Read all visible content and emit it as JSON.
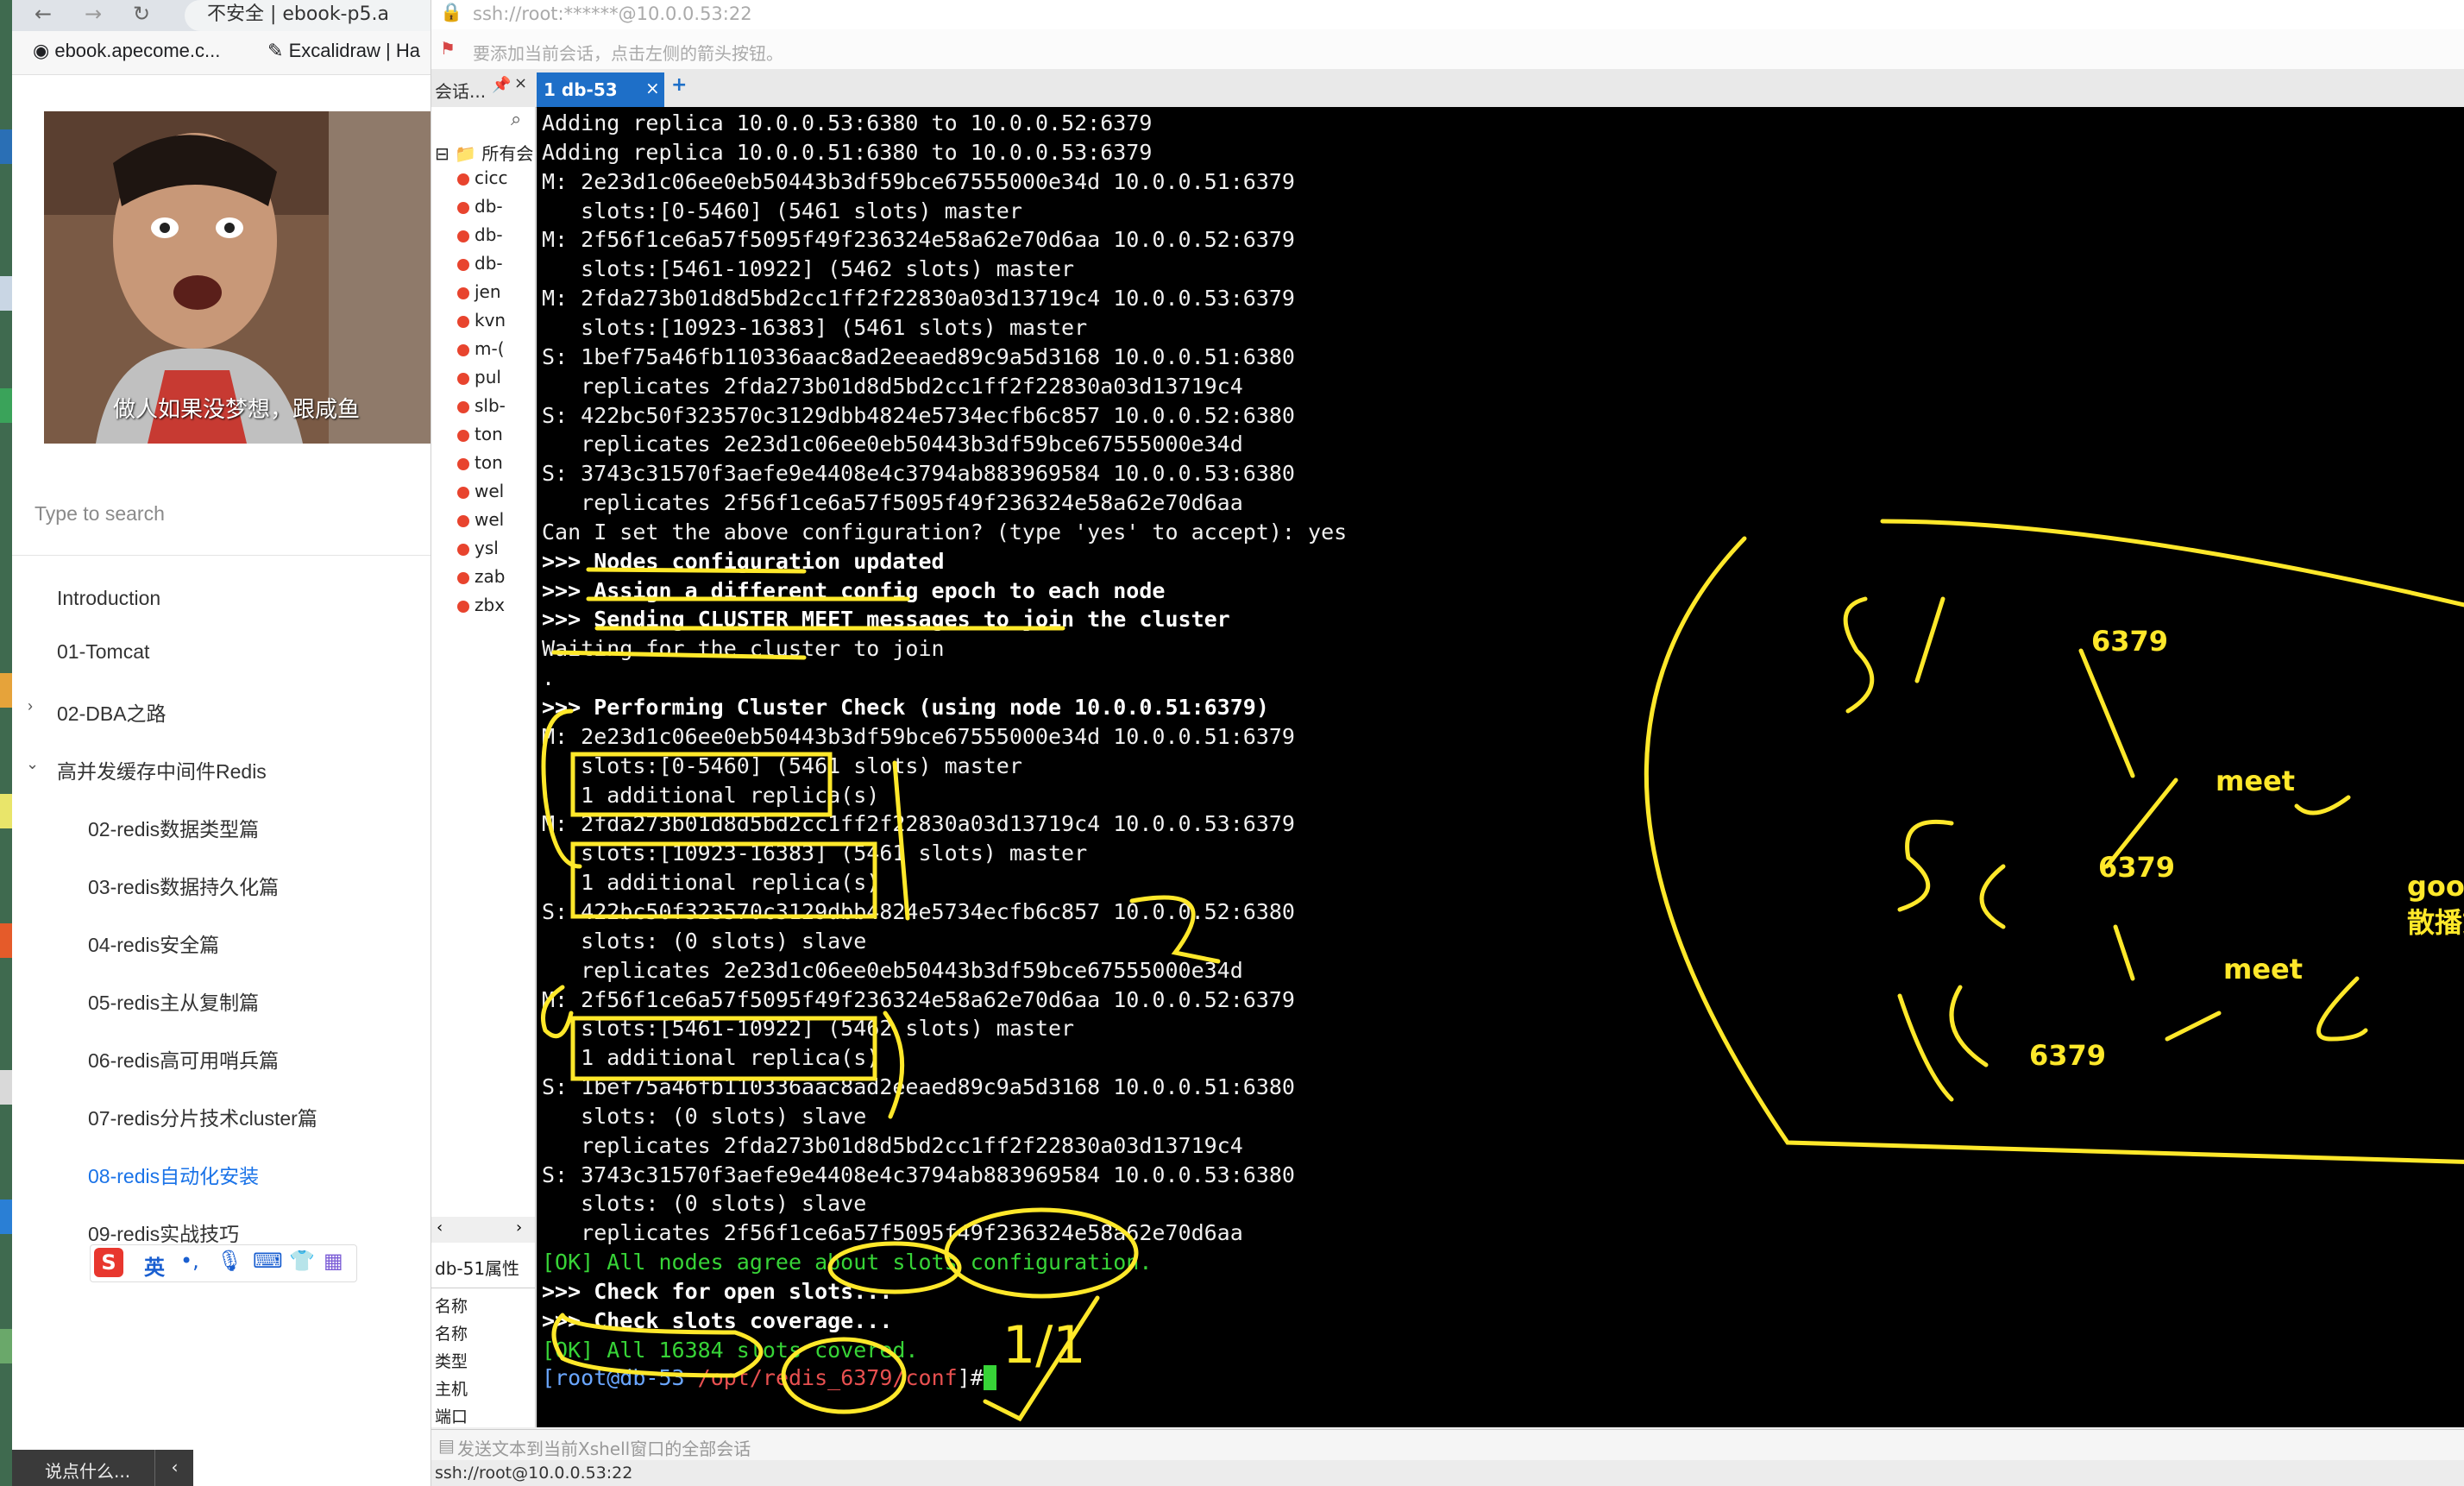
{
  "browser": {
    "tab_partial": "不安全 | ebook-p5.a",
    "bookmarks": [
      "ebook.apecome.c...",
      "Excalidraw | Ha"
    ],
    "meme_caption": "做人如果没梦想，跟咸鱼",
    "search_placeholder": "Type to search",
    "nav": [
      "Introduction",
      "01-Tomcat",
      "02-DBA之路",
      "高并发缓存中间件Redis",
      "02-redis数据类型篇",
      "03-redis数据持久化篇",
      "04-redis安全篇",
      "05-redis主从复制篇",
      "06-redis高可用哨兵篇",
      "07-redis分片技术cluster篇",
      "08-redis自动化安装",
      "09-redis实战技巧"
    ],
    "ime_label": "英",
    "bottom_comment": "说点什么..."
  },
  "xshell": {
    "address": "ssh://root:******@10.0.0.53:22",
    "hint": "要添加当前会话，点击左侧的箭头按钮。",
    "session_tab": "会话...",
    "active_tab": "1 db-53",
    "tree_root": "所有会",
    "sessions": [
      "cicc",
      "db-",
      "db-",
      "db-",
      "jen",
      "kvn",
      "m-(",
      "pul",
      "slb-",
      "ton",
      "ton",
      "wel",
      "wel",
      "ysl",
      "zab",
      "zbx"
    ],
    "props_title": "db-51属性",
    "props": [
      "名称",
      "名称",
      "类型",
      "主机",
      "端口"
    ],
    "send_bar": "发送文本到当前Xshell窗口的全部会话",
    "status": "ssh://root@10.0.0.53:22",
    "terminal_lines": [
      {
        "t": "Adding replica 10.0.0.53:6380 to 10.0.0.52:6379",
        "s": ""
      },
      {
        "t": "Adding replica 10.0.0.51:6380 to 10.0.0.53:6379",
        "s": ""
      },
      {
        "t": "M: 2e23d1c06ee0eb50443b3df59bce67555000e34d 10.0.0.51:6379",
        "s": ""
      },
      {
        "t": "   slots:[0-5460] (5461 slots) master",
        "s": ""
      },
      {
        "t": "M: 2f56f1ce6a57f5095f49f236324e58a62e70d6aa 10.0.0.52:6379",
        "s": ""
      },
      {
        "t": "   slots:[5461-10922] (5462 slots) master",
        "s": ""
      },
      {
        "t": "M: 2fda273b01d8d5bd2cc1ff2f22830a03d13719c4 10.0.0.53:6379",
        "s": ""
      },
      {
        "t": "   slots:[10923-16383] (5461 slots) master",
        "s": ""
      },
      {
        "t": "S: 1bef75a46fb110336aac8ad2eeaed89c9a5d3168 10.0.0.51:6380",
        "s": ""
      },
      {
        "t": "   replicates 2fda273b01d8d5bd2cc1ff2f22830a03d13719c4",
        "s": ""
      },
      {
        "t": "S: 422bc50f323570c3129dbb4824e5734ecfb6c857 10.0.0.52:6380",
        "s": ""
      },
      {
        "t": "   replicates 2e23d1c06ee0eb50443b3df59bce67555000e34d",
        "s": ""
      },
      {
        "t": "S: 3743c31570f3aefe9e4408e4c3794ab883969584 10.0.0.53:6380",
        "s": ""
      },
      {
        "t": "   replicates 2f56f1ce6a57f5095f49f236324e58a62e70d6aa",
        "s": ""
      },
      {
        "t": "Can I set the above configuration? (type 'yes' to accept): yes",
        "s": ""
      },
      {
        "t": ">>> Nodes configuration updated",
        "s": "b"
      },
      {
        "t": ">>> Assign a different config epoch to each node",
        "s": "b"
      },
      {
        "t": ">>> Sending CLUSTER MEET messages to join the cluster",
        "s": "b"
      },
      {
        "t": "Waiting for the cluster to join",
        "s": ""
      },
      {
        "t": ".",
        "s": ""
      },
      {
        "t": ">>> Performing Cluster Check (using node 10.0.0.51:6379)",
        "s": "b"
      },
      {
        "t": "M: 2e23d1c06ee0eb50443b3df59bce67555000e34d 10.0.0.51:6379",
        "s": ""
      },
      {
        "t": "   slots:[0-5460] (5461 slots) master",
        "s": ""
      },
      {
        "t": "   1 additional replica(s)",
        "s": ""
      },
      {
        "t": "M: 2fda273b01d8d5bd2cc1ff2f22830a03d13719c4 10.0.0.53:6379",
        "s": ""
      },
      {
        "t": "   slots:[10923-16383] (5461 slots) master",
        "s": ""
      },
      {
        "t": "   1 additional replica(s)",
        "s": ""
      },
      {
        "t": "S: 422bc50f323570c3129dbb4824e5734ecfb6c857 10.0.0.52:6380",
        "s": ""
      },
      {
        "t": "   slots: (0 slots) slave",
        "s": ""
      },
      {
        "t": "   replicates 2e23d1c06ee0eb50443b3df59bce67555000e34d",
        "s": ""
      },
      {
        "t": "M: 2f56f1ce6a57f5095f49f236324e58a62e70d6aa 10.0.0.52:6379",
        "s": ""
      },
      {
        "t": "   slots:[5461-10922] (5462 slots) master",
        "s": ""
      },
      {
        "t": "   1 additional replica(s)",
        "s": ""
      },
      {
        "t": "S: 1bef75a46fb110336aac8ad2eeaed89c9a5d3168 10.0.0.51:6380",
        "s": ""
      },
      {
        "t": "   slots: (0 slots) slave",
        "s": ""
      },
      {
        "t": "   replicates 2fda273b01d8d5bd2cc1ff2f22830a03d13719c4",
        "s": ""
      },
      {
        "t": "S: 3743c31570f3aefe9e4408e4c3794ab883969584 10.0.0.53:6380",
        "s": ""
      },
      {
        "t": "   slots: (0 slots) slave",
        "s": ""
      },
      {
        "t": "   replicates 2f56f1ce6a57f5095f49f236324e58a62e70d6aa",
        "s": ""
      },
      {
        "t": "[OK] All nodes agree about slots configuration.",
        "s": "g"
      },
      {
        "t": ">>> Check for open slots...",
        "s": "b"
      },
      {
        "t": ">>> Check slots coverage...",
        "s": "b"
      },
      {
        "t": "[OK] All 16384 slots covered.",
        "s": "g"
      }
    ],
    "prompt_user": "[root@db-53",
    "prompt_path": "/opt/redis_6379/conf",
    "prompt_end": "]#"
  },
  "annotations": {
    "port_1": "6379",
    "port_2": "6379",
    "port_3": "6379",
    "meet_1": "meet",
    "meet_2": "meet",
    "protocol_1": "goosip协议",
    "protocol_2": "散播式病毒协议",
    "num_1": "51",
    "num_2": "52",
    "num_3": "53",
    "count": "1/1",
    "bracket_num": "2"
  }
}
